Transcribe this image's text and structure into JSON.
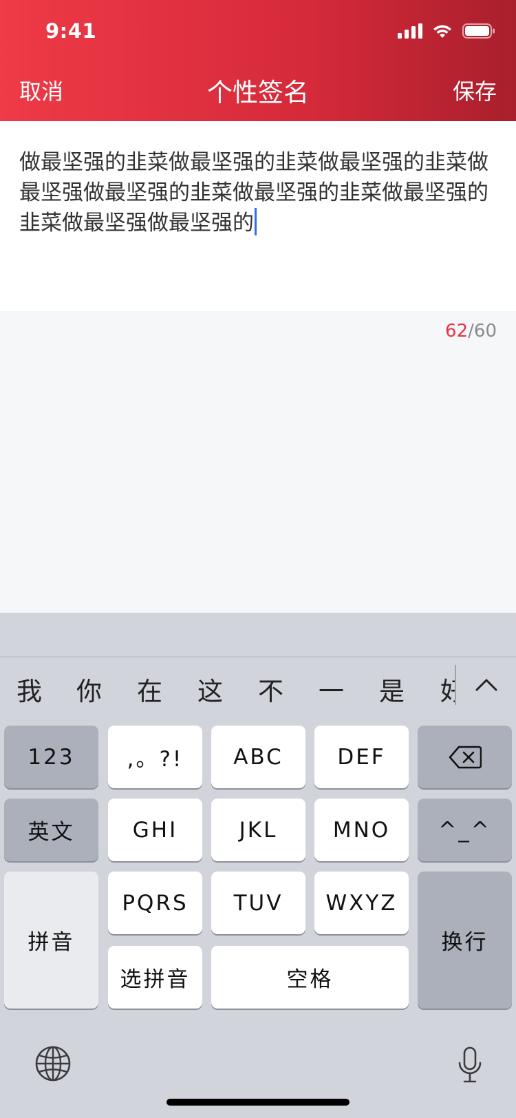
{
  "status_bar": {
    "time": "9:41",
    "icons": [
      "cellular-signal-icon",
      "wifi-icon",
      "battery-icon"
    ]
  },
  "nav": {
    "cancel": "取消",
    "title": "个性签名",
    "save": "保存"
  },
  "editor": {
    "text": "做最坚强的韭菜做最坚强的韭菜做最坚强的韭菜做最坚强做最坚强的韭菜做最坚强的韭菜做最坚强的韭菜做最坚强做最坚强的"
  },
  "counter": {
    "current": "62",
    "separator": "/",
    "max": "60"
  },
  "keyboard": {
    "candidates": [
      "我",
      "你",
      "在",
      "这",
      "不",
      "一",
      "是",
      "好"
    ],
    "keys": {
      "num": "123",
      "punct": ",。?!",
      "abc": "ABC",
      "def": "DEF",
      "english": "英文",
      "ghi": "GHI",
      "jkl": "JKL",
      "mno": "MNO",
      "emoticon": "^_^",
      "pinyin": "拼音",
      "pqrs": "PQRS",
      "tuv": "TUV",
      "wxyz": "WXYZ",
      "return": "换行",
      "select_pinyin": "选拼音",
      "space": "空格"
    }
  },
  "colors": {
    "header_start": "#ef3a47",
    "header_end": "#a91f2c",
    "counter_over": "#e33448",
    "cursor": "#2c6ff1"
  }
}
